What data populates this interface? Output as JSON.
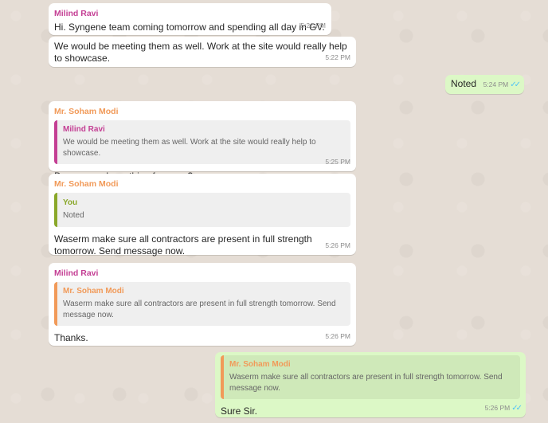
{
  "messages": [
    {
      "sender": "Milind Ravi",
      "text": "Hi. Syngene team coming tomorrow and spending all day in GV.",
      "time": "5:21 PM"
    },
    {
      "text": "We would be meeting them as well. Work at the site would really help to showcase.",
      "time": "5:22 PM"
    },
    {
      "text": "Noted",
      "time": "5:24 PM",
      "ticks": "✓✓"
    },
    {
      "sender": "Mr. Soham Modi",
      "quote_name": "Milind Ravi",
      "quote_text": "We would be meeting them as well. Work at the site would really help to showcase.",
      "text": "Do you need any thing from me?",
      "time": "5:25 PM"
    },
    {
      "sender": "Mr. Soham Modi",
      "quote_name": "You",
      "quote_text": "Noted",
      "text": "Waserm make sure all contractors are present in full strength tomorrow. Send message now.",
      "time": "5:26 PM"
    },
    {
      "sender": "Milind Ravi",
      "quote_name": "Mr. Soham Modi",
      "quote_text": "Waserm make sure all contractors are present in full strength tomorrow. Send message now.",
      "text": "Thanks.",
      "time": "5:26 PM"
    },
    {
      "quote_name": "Mr. Soham Modi",
      "quote_text": "Waserm make sure all contractors are present in full strength tomorrow. Send message now.",
      "text": "Sure Sir.",
      "time": "5:26 PM",
      "ticks": "✓✓"
    }
  ]
}
